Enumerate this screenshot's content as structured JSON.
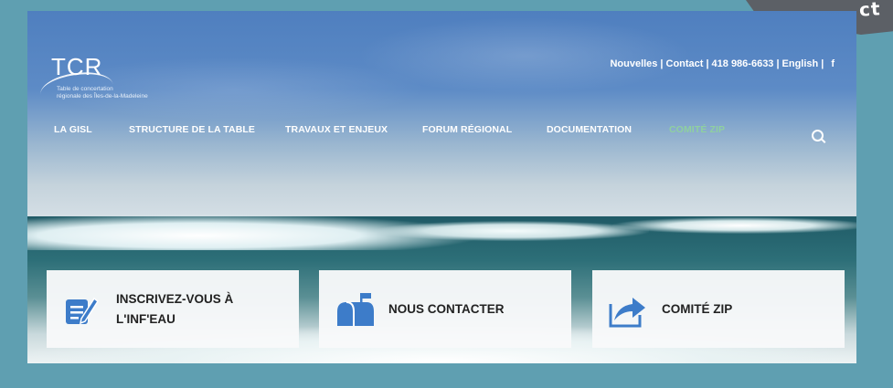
{
  "corner_text": "ct",
  "logo": {
    "name": "TCR",
    "tagline_line1": "Table de concertation",
    "tagline_line2": "régionale des Îles-de-la-Madeleine"
  },
  "top_links": {
    "news": "Nouvelles",
    "contact": "Contact",
    "phone": "418 986-6633",
    "english": "English",
    "facebook_icon": "f"
  },
  "nav": {
    "items": [
      {
        "label": "LA GISL"
      },
      {
        "label": "STRUCTURE DE LA TABLE"
      },
      {
        "label": "TRAVAUX ET ENJEUX"
      },
      {
        "label": "FORUM RÉGIONAL"
      },
      {
        "label": "DOCUMENTATION"
      },
      {
        "label": "COMITÉ ZIP"
      }
    ],
    "active_color": "#8fd0a0"
  },
  "cards": [
    {
      "label": "INSCRIVEZ-VOUS À L'INF'EAU",
      "icon": "edit-form-icon"
    },
    {
      "label": "NOUS CONTACTER",
      "icon": "mailbox-icon"
    },
    {
      "label": "COMITÉ ZIP",
      "icon": "share-arrow-icon"
    }
  ],
  "colors": {
    "page_border": "#5f9fb1",
    "icon_blue": "#3d7cc9"
  }
}
